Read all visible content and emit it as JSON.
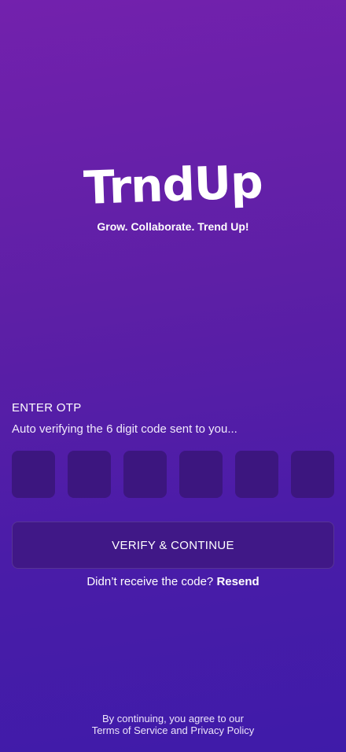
{
  "brand": {
    "logo_text": "TrndUp",
    "tagline": "Grow. Collaborate. Trend Up!"
  },
  "otp": {
    "label": "ENTER OTP",
    "subtitle": "Auto verifying the 6 digit code sent to you...",
    "digits": [
      "",
      "",
      "",
      "",
      "",
      ""
    ]
  },
  "actions": {
    "verify_label": "VERIFY & CONTINUE",
    "resend_prompt": "Didn’t receive the code?",
    "resend_label": "Resend"
  },
  "footer": {
    "line1": "By continuing, you agree to our",
    "line2": "Terms of Service and Privacy Policy"
  },
  "colors": {
    "gradient_top": "#7321ad",
    "gradient_bottom": "#3f1ba9",
    "otp_box": "#3c167f",
    "button": "#401887"
  }
}
